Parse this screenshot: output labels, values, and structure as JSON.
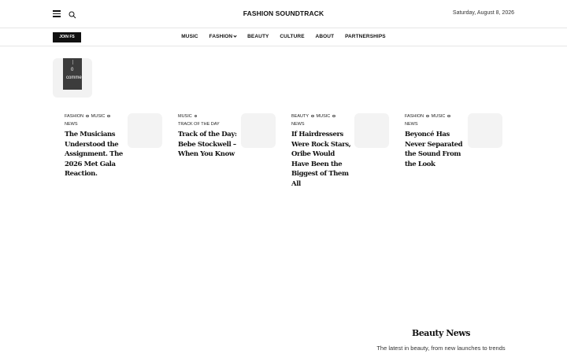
{
  "header": {
    "site_title": "FASHION SOUNDTRACK",
    "date": "Saturday, August 8, 2026",
    "menu_icon": "hamburger-menu-icon",
    "search_icon": "search-icon"
  },
  "nav": {
    "join_label": "JOIN FS",
    "items": [
      {
        "label": "MUSIC"
      },
      {
        "label": "FASHION",
        "has_dropdown": true
      },
      {
        "label": "BEAUTY"
      },
      {
        "label": "CULTURE"
      },
      {
        "label": "ABOUT"
      },
      {
        "label": "PARTNERSHIPS"
      }
    ]
  },
  "comments": {
    "count": "0",
    "label": "comments"
  },
  "articles": [
    {
      "categories": [
        "FASHION",
        "MUSIC",
        "NEWS"
      ],
      "title": "The Musicians Understood the Assignment. The 2026 Met Gala Reaction."
    },
    {
      "categories": [
        "MUSIC",
        "TRACK OF THE DAY"
      ],
      "title": "Track of the Day: Bebe Stockwell – When You Know"
    },
    {
      "categories": [
        "BEAUTY",
        "MUSIC",
        "NEWS"
      ],
      "title": "If Hairdressers Were Rock Stars, Oribe Would Have Been the Biggest of Them All"
    },
    {
      "categories": [
        "FASHION",
        "MUSIC",
        "NEWS"
      ],
      "title": "Beyoncé Has Never Separated the Sound From the Look"
    }
  ],
  "beauty_section": {
    "title": "Beauty News",
    "subtitle": "The latest in beauty, from new launches to trends"
  }
}
